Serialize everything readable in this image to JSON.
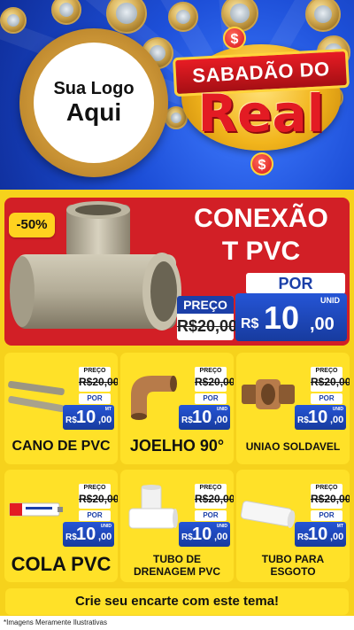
{
  "header": {
    "logo_line1": "Sua Logo",
    "logo_line2": "Aqui",
    "promo_top": "SABADÃO DO",
    "promo_big": "Real",
    "dollar_sign": "$"
  },
  "featured": {
    "discount": "-50%",
    "title_line1": "CONEXÃO",
    "title_line2": "T PVC",
    "por_label": "POR",
    "preco_label": "PREÇO",
    "old_price": "R$20,00",
    "new_currency": "R$",
    "new_price": "10",
    "new_cents": ",00",
    "unit": "UNID"
  },
  "products": [
    {
      "name": "CANO DE PVC",
      "preco_label": "PREÇO",
      "old_price": "R$20,00",
      "por_label": "POR",
      "currency": "R$",
      "price": "10",
      "cents": ",00",
      "unit": "MT"
    },
    {
      "name": "JOELHO 90°",
      "preco_label": "PREÇO",
      "old_price": "R$20,00",
      "por_label": "POR",
      "currency": "R$",
      "price": "10",
      "cents": ",00",
      "unit": "UNID"
    },
    {
      "name": "UNIAO SOLDAVEL",
      "preco_label": "PREÇO",
      "old_price": "R$20,00",
      "por_label": "POR",
      "currency": "R$",
      "price": "10",
      "cents": ",00",
      "unit": "UNID"
    },
    {
      "name": "COLA PVC",
      "preco_label": "PREÇO",
      "old_price": "R$20,00",
      "por_label": "POR",
      "currency": "R$",
      "price": "10",
      "cents": ",00",
      "unit": "UNID"
    },
    {
      "name_line1": "TUBO DE",
      "name_line2": "DRENAGEM PVC",
      "preco_label": "PREÇO",
      "old_price": "R$20,00",
      "por_label": "POR",
      "currency": "R$",
      "price": "10",
      "cents": ",00",
      "unit": "UNID"
    },
    {
      "name_line1": "TUBO PARA",
      "name_line2": "ESGOTO",
      "preco_label": "PREÇO",
      "old_price": "R$20,00",
      "por_label": "POR",
      "currency": "R$",
      "price": "10",
      "cents": ",00",
      "unit": "MT"
    }
  ],
  "cta": "Crie seu encarte com este tema!",
  "disclaimer": "*Imagens Meramente Ilustrativas",
  "colors": {
    "red": "#d21f26",
    "blue": "#1b3fa8",
    "yellow": "#ffe128",
    "background": "#f6d21c"
  }
}
